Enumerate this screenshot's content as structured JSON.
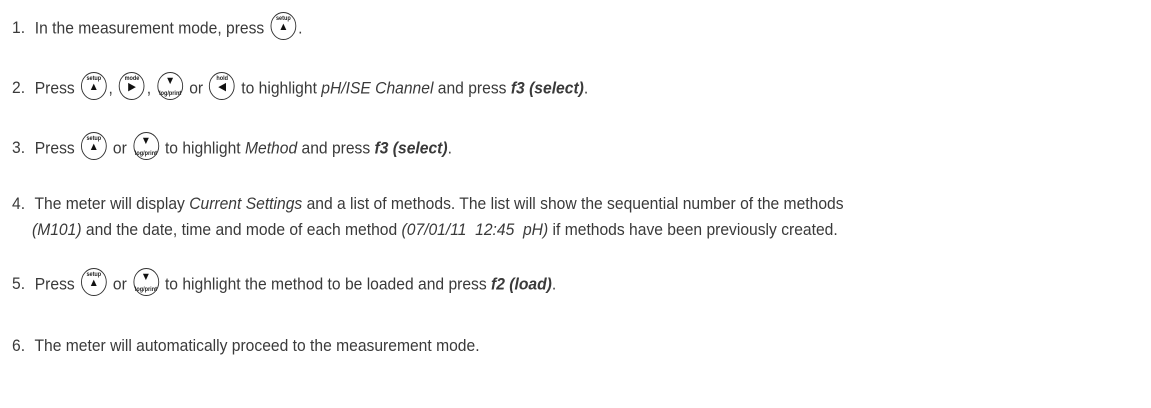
{
  "keys": {
    "setup": {
      "label": "setup",
      "arrow": "▲"
    },
    "mode": {
      "label": "mode",
      "arrow": "▶"
    },
    "logprint": {
      "label": "log/print",
      "arrow": "▼"
    },
    "hold": {
      "label": "hold",
      "arrow": "◀"
    }
  },
  "steps": [
    {
      "num": "1.",
      "t1": "In the measurement mode, press",
      "t2": "."
    },
    {
      "num": "2.",
      "t1": "Press",
      "sep1": ",",
      "sep2": ",",
      "or": "or",
      "t2": "to highlight",
      "em1": "pH/ISE Channel",
      "t3": "and press",
      "strong1": "f3 (select)",
      "t4": "."
    },
    {
      "num": "3.",
      "t1": "Press",
      "or": "or",
      "t2": "to highlight",
      "em1": "Method",
      "t3": "and press",
      "strong1": "f3 (select)",
      "t4": "."
    },
    {
      "num": "4.",
      "t1": "The meter will display",
      "em1": "Current Settings",
      "t2": "and a list of methods. The list will show the sequential number of the methods",
      "em2": "(M101)",
      "t3": "and the date, time and mode of each method",
      "em3": "(07/01/11  12:45  pH)",
      "t4": "if methods have been previously created."
    },
    {
      "num": "5.",
      "t1": "Press",
      "or": "or",
      "t2": "to highlight the method to be loaded and press",
      "strong1": "f2 (load)",
      "t3": "."
    },
    {
      "num": "6.",
      "t1": "The meter will automatically proceed to the measurement mode."
    }
  ]
}
